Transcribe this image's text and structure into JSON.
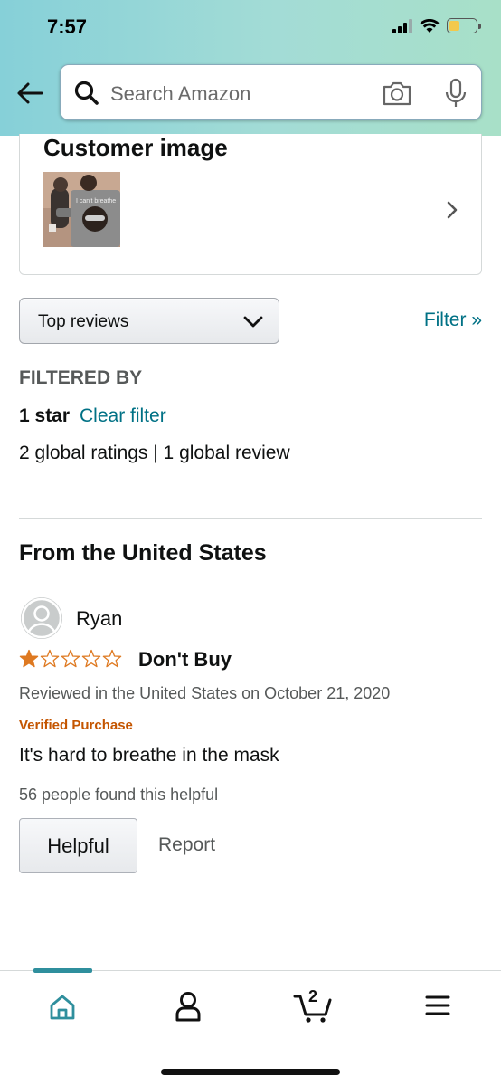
{
  "status_bar": {
    "time": "7:57"
  },
  "search": {
    "placeholder": "Search Amazon"
  },
  "customer_images": {
    "title": "Customer image",
    "thumbnail_caption": "I can't breathe"
  },
  "sort": {
    "selected": "Top reviews",
    "filter_link": "Filter »"
  },
  "filter": {
    "heading": "FILTERED BY",
    "active": "1 star",
    "clear": "Clear filter"
  },
  "ratings_summary": "2 global ratings | 1 global review",
  "region_heading": "From the United States",
  "review": {
    "reviewer": "Ryan",
    "rating": 1,
    "rating_max": 5,
    "title": "Don't Buy",
    "meta": "Reviewed in the United States on October 21, 2020",
    "verified": "Verified Purchase",
    "body": "It's hard to breathe in the mask",
    "helpful_count": "56 people found this helpful",
    "helpful_button": "Helpful",
    "report_link": "Report"
  },
  "bottom_nav": {
    "cart_count": "2",
    "active": "home"
  },
  "colors": {
    "link": "#007185",
    "verified": "#c45500",
    "star": "#de7921",
    "header_start": "#86d0d8",
    "header_end": "#a8e0c8",
    "active_tab": "#2f8f9d"
  },
  "icons": [
    "back-arrow-icon",
    "search-icon",
    "camera-icon",
    "microphone-icon",
    "chevron-right-icon",
    "chevron-down-icon",
    "star-icon",
    "avatar-icon",
    "home-icon",
    "account-icon",
    "cart-icon",
    "menu-icon"
  ]
}
